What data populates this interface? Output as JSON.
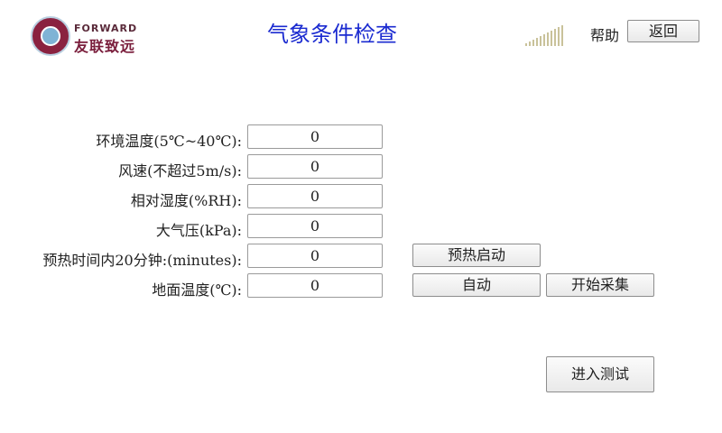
{
  "header": {
    "logo_en": "FORWARD",
    "logo_cn": "友联致远",
    "title": "气象条件检查",
    "help_label": "帮助",
    "back_label": "返回"
  },
  "form": {
    "rows": [
      {
        "label": "环境温度(5℃~40℃):",
        "value": "0"
      },
      {
        "label": "风速(不超过5m/s):",
        "value": "0"
      },
      {
        "label": "相对湿度(%RH):",
        "value": "0"
      },
      {
        "label": "大气压(kPa):",
        "value": "0"
      },
      {
        "label": "预热时间内20分钟:(minutes):",
        "value": "0"
      },
      {
        "label": "地面温度(℃):",
        "value": "0"
      }
    ]
  },
  "actions": {
    "preheat_label": "预热启动",
    "auto_label": "自动",
    "collect_label": "开始采集",
    "enter_test_label": "进入测试"
  },
  "colors": {
    "title": "#1a2ad0",
    "logo_primary": "#7a1e3c",
    "signal": "#c9c29a"
  }
}
